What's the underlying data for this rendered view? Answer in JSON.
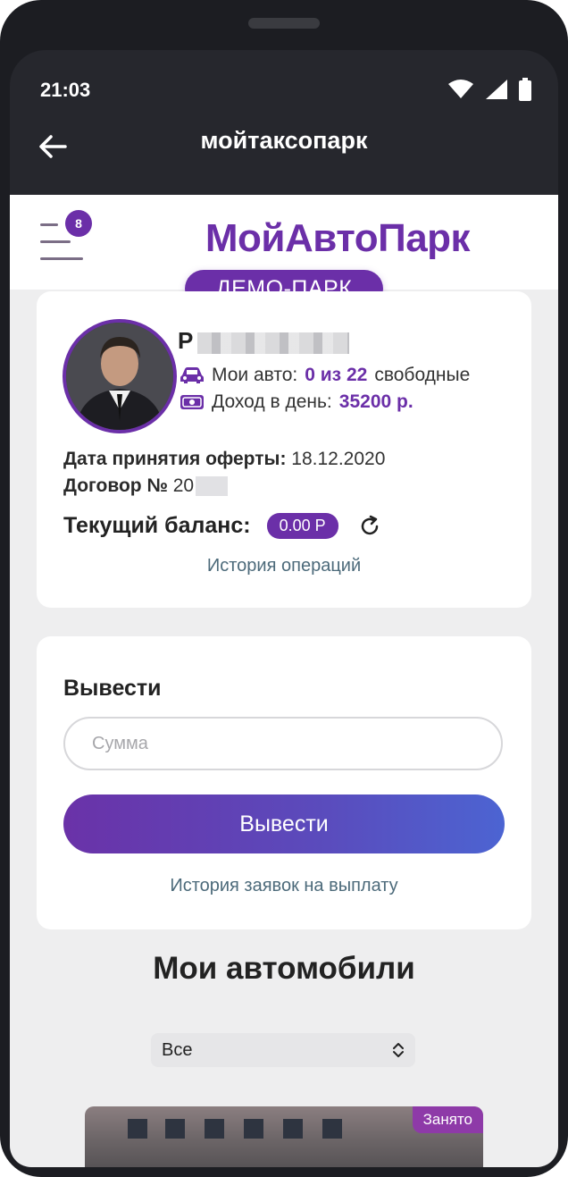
{
  "statusbar": {
    "time": "21:03"
  },
  "appbar": {
    "title": "мойтаксопарк"
  },
  "site": {
    "logo": "МойАвтоПарк",
    "demo_label": "ДЕМО-ПАРК",
    "notification_count": "8"
  },
  "profile": {
    "name_initial": "Р",
    "cars_label": "Мои авто:",
    "cars_value": "0 из 22",
    "cars_suffix": "свободные",
    "income_label": "Доход в день:",
    "income_value": "35200 р.",
    "offer_label": "Дата принятия оферты:",
    "offer_date": "18.12.2020",
    "contract_label": "Договор №",
    "contract_value": "20",
    "balance_label": "Текущий баланс:",
    "balance_value": "0.00 Р",
    "history_link": "История операций"
  },
  "withdraw": {
    "title": "Вывести",
    "amount_placeholder": "Сумма",
    "button_label": "Вывести",
    "history_link": "История заявок на выплату"
  },
  "cars": {
    "title": "Мои автомобили",
    "filter_value": "Все",
    "first_car_status": "Занято"
  },
  "colors": {
    "brand": "#6b2fa8",
    "link": "#4c6a7a",
    "status_bar": "#26272d"
  }
}
